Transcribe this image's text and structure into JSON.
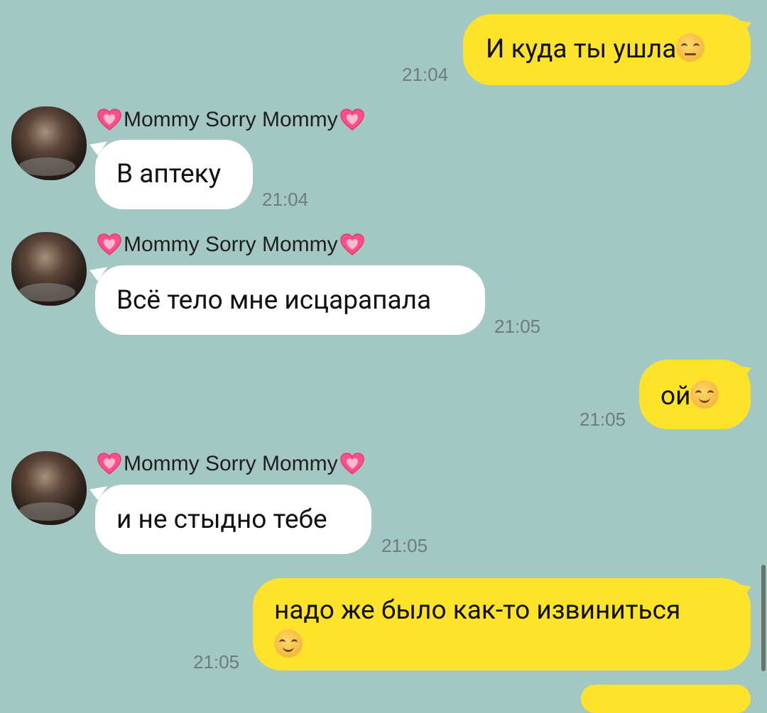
{
  "chat": {
    "contact_name": "Mommy Sorry Mommy",
    "messages": [
      {
        "id": "m1",
        "direction": "out",
        "text": "И куда ты ушла",
        "emoji": "unamused-face",
        "time": "21:04"
      },
      {
        "id": "m2",
        "direction": "in",
        "text": "В аптеку",
        "time": "21:04"
      },
      {
        "id": "m3",
        "direction": "in",
        "text": "Всё тело мне исцарапала",
        "time": "21:05"
      },
      {
        "id": "m4",
        "direction": "out",
        "text": "ой",
        "emoji": "smiling-face",
        "time": "21:05"
      },
      {
        "id": "m5",
        "direction": "in",
        "text": "и не стыдно тебе",
        "time": "21:05"
      },
      {
        "id": "m6",
        "direction": "out",
        "text": "надо же было как-то извиниться",
        "emoji": "smiling-face-with-smiling-eyes",
        "time": "21:05"
      }
    ]
  },
  "colors": {
    "background": "#a3c7c2",
    "outgoing_bubble": "#ffe32b",
    "incoming_bubble": "#ffffff",
    "time_text": "#6d7d7b",
    "heart": "#ff4f8b"
  },
  "icons": {
    "sender_decoration": "sparkling-heart-icon",
    "avatar": "contact-avatar-photo"
  }
}
